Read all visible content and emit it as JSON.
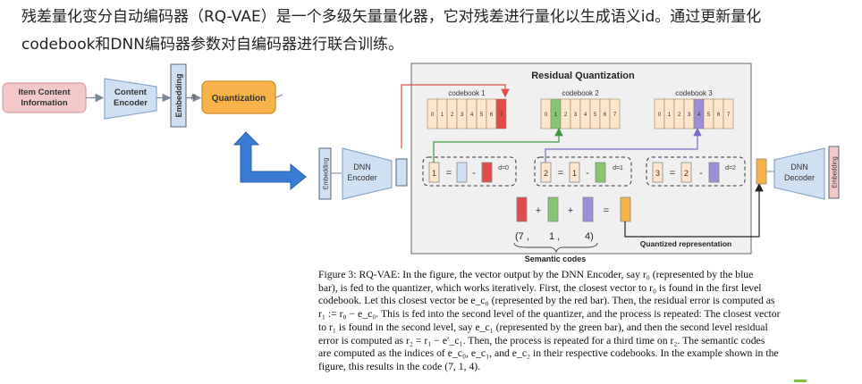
{
  "intro": {
    "line1": "残差量化变分自动编码器（RQ-VAE）是一个多级矢量量化器，它对残差进行量化以生成语义id。通过更新量化",
    "line2": "codebook和DNN编码器参数对自编码器进行联合训练。"
  },
  "pipeline": {
    "item_content_l1": "Item Content",
    "item_content_l2": "Information",
    "content_encoder_l1": "Content",
    "content_encoder_l2": "Encoder",
    "embedding": "Embedding",
    "hash": "#",
    "quantization": "Quantization"
  },
  "rq": {
    "title": "Residual Quantization",
    "codebooks": [
      {
        "label": "codebook  1",
        "cells": [
          "0",
          "1",
          "2",
          "3",
          "4",
          "5",
          "6",
          "7"
        ],
        "highlight": 7
      },
      {
        "label": "codebook  2",
        "cells": [
          "0",
          "1",
          "2",
          "3",
          "4",
          "5",
          "6",
          "7"
        ],
        "highlight": 1
      },
      {
        "label": "codebook  3",
        "cells": [
          "0",
          "1",
          "2",
          "3",
          "4",
          "5",
          "6",
          "7"
        ],
        "highlight": 4
      }
    ],
    "embedding_left": "Embedding",
    "embedding_right": "Embedding",
    "dnn_encoder_l1": "DNN",
    "dnn_encoder_l2": "Encoder",
    "dnn_decoder_l1": "DNN",
    "dnn_decoder_l2": "Decoder",
    "residuals": [
      {
        "lhs": "1",
        "rhs": "",
        "depth": "d=0"
      },
      {
        "lhs": "2",
        "rhs": "1",
        "depth": "d=1"
      },
      {
        "lhs": "3",
        "rhs": "2",
        "depth": "d=2"
      }
    ],
    "equals": "=",
    "minus": "-",
    "plus": "+",
    "code_tuple": {
      "open": "(7 ,",
      "mid": "1 ,",
      "close": "4)"
    },
    "semantic_codes": "Semantic codes",
    "quantized_representation": "Quantized representation"
  },
  "caption": {
    "lines": [
      "Figure 3: RQ-VAE: In the figure, the vector output by the DNN Encoder, say r₀ (represented by the blue",
      "bar), is fed to the quantizer, which works iteratively.  First, the closest vector to r₀ is found in the first level",
      "codebook. Let this closest vector be e_c₀ (represented by the red bar). Then, the residual error is computed as",
      "r₁ := r₀ − e_c₀. This is fed into the second level of the quantizer, and the process is repeated: The closest vector",
      "to r₁ is found in the second level, say e_c₁ (represented by the green bar), and then the second level residual",
      "error is computed as r₂ = r₁ − e′_c₁. Then, the process is repeated for a third time on r₂. The semantic codes",
      "are computed as the indices of e_c₀, e_c₁, and e_c₂ in their respective codebooks. In the example shown in the",
      "figure, this results in the code (7, 1, 4)."
    ]
  },
  "colors": {
    "pink": "#f4c8c8",
    "blue_light": "#cfe0f3",
    "orange": "#f7b24a",
    "red": "#e04b4b",
    "green": "#86c673",
    "purple": "#9b8fd6",
    "cell": "#fde6cb",
    "arrow_blue": "#3a7bd5"
  }
}
